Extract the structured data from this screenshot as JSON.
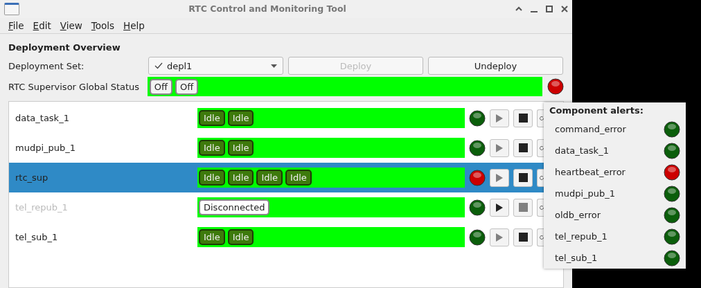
{
  "window": {
    "title": "RTC Control and Monitoring Tool"
  },
  "menu": [
    "File",
    "Edit",
    "View",
    "Tools",
    "Help"
  ],
  "section_title": "Deployment Overview",
  "deployment_set": {
    "label": "Deployment Set:",
    "value": "depl1",
    "checked": true
  },
  "buttons": [
    {
      "label": "Deploy",
      "disabled": true
    },
    {
      "label": "Undeploy",
      "disabled": false
    }
  ],
  "global_status": {
    "label": "RTC Supervisor Global Status",
    "chips": [
      {
        "text": "Off",
        "kind": "off"
      },
      {
        "text": "Off",
        "kind": "off"
      }
    ],
    "color": "#cc0000"
  },
  "components": [
    {
      "name": "data_task_1",
      "selected": false,
      "disabled": false,
      "chips": [
        {
          "text": "Idle",
          "kind": "idle"
        },
        {
          "text": "Idle",
          "kind": "idle"
        }
      ],
      "color": "#0b5e0b",
      "controls": [
        {
          "kind": "play",
          "disabled": true
        },
        {
          "kind": "stop",
          "disabled": false
        },
        {
          "kind": "reset",
          "disabled": false
        }
      ]
    },
    {
      "name": "mudpi_pub_1",
      "selected": false,
      "disabled": false,
      "chips": [
        {
          "text": "Idle",
          "kind": "idle"
        },
        {
          "text": "Idle",
          "kind": "idle"
        }
      ],
      "color": "#0b5e0b",
      "controls": [
        {
          "kind": "play",
          "disabled": true
        },
        {
          "kind": "stop",
          "disabled": false
        },
        {
          "kind": "reset",
          "disabled": false
        }
      ]
    },
    {
      "name": "rtc_sup",
      "selected": true,
      "disabled": false,
      "chips": [
        {
          "text": "Idle",
          "kind": "idle"
        },
        {
          "text": "Idle",
          "kind": "idle"
        },
        {
          "text": "Idle",
          "kind": "idle"
        },
        {
          "text": "Idle",
          "kind": "idle"
        }
      ],
      "color": "#cc0000",
      "controls": [
        {
          "kind": "play",
          "disabled": true
        },
        {
          "kind": "stop",
          "disabled": false
        },
        {
          "kind": "reset",
          "disabled": false
        }
      ]
    },
    {
      "name": "tel_repub_1",
      "selected": false,
      "disabled": true,
      "chips": [
        {
          "text": "Disconnected",
          "kind": "disconnected"
        }
      ],
      "color": "#0b5e0b",
      "controls": [
        {
          "kind": "play",
          "disabled": false
        },
        {
          "kind": "stop",
          "disabled": true
        },
        {
          "kind": "reset",
          "disabled": false
        }
      ]
    },
    {
      "name": "tel_sub_1",
      "selected": false,
      "disabled": false,
      "chips": [
        {
          "text": "Idle",
          "kind": "idle"
        },
        {
          "text": "Idle",
          "kind": "idle"
        }
      ],
      "color": "#0b5e0b",
      "controls": [
        {
          "kind": "play",
          "disabled": true
        },
        {
          "kind": "stop",
          "disabled": false
        },
        {
          "kind": "reset",
          "disabled": false
        }
      ]
    }
  ],
  "alerts_popup": {
    "title": "Component alerts:",
    "items": [
      {
        "name": "command_error",
        "color": "#0b5e0b"
      },
      {
        "name": "data_task_1",
        "color": "#0b5e0b"
      },
      {
        "name": "heartbeat_error",
        "color": "#cc0000"
      },
      {
        "name": "mudpi_pub_1",
        "color": "#0b5e0b"
      },
      {
        "name": "oldb_error",
        "color": "#0b5e0b"
      },
      {
        "name": "tel_repub_1",
        "color": "#0b5e0b"
      },
      {
        "name": "tel_sub_1",
        "color": "#0b5e0b"
      }
    ]
  }
}
